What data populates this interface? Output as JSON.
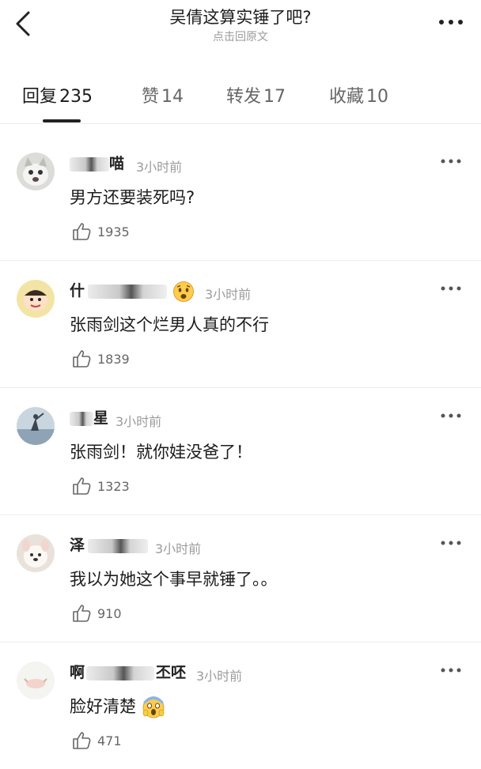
{
  "header": {
    "title": "吴倩这算实锤了吧?",
    "subtitle": "点击回原文"
  },
  "tabs": [
    {
      "label": "回复",
      "count": "235",
      "active": true
    },
    {
      "label": "赞",
      "count": "14",
      "active": false
    },
    {
      "label": "转发",
      "count": "17",
      "active": false
    },
    {
      "label": "收藏",
      "count": "10",
      "active": false
    }
  ],
  "comments": [
    {
      "name_visible": "喵",
      "time": "3小时前",
      "text": "男方还要装死吗?",
      "likes": "1935"
    },
    {
      "name_visible": "什",
      "time": "3小时前",
      "text": "张雨剑这个烂男人真的不行",
      "likes": "1839"
    },
    {
      "name_visible": "星",
      "time": "3小时前",
      "text": "张雨剑！就你娃没爸了！",
      "likes": "1323"
    },
    {
      "name_visible": "泽",
      "time": "3小时前",
      "text": "我以为她这个事早就锤了。。",
      "likes": "910"
    },
    {
      "name_visible_start": "啊",
      "name_visible_end": "丕呸",
      "time": "3小时前",
      "text": "脸好清楚",
      "likes": "471"
    }
  ]
}
